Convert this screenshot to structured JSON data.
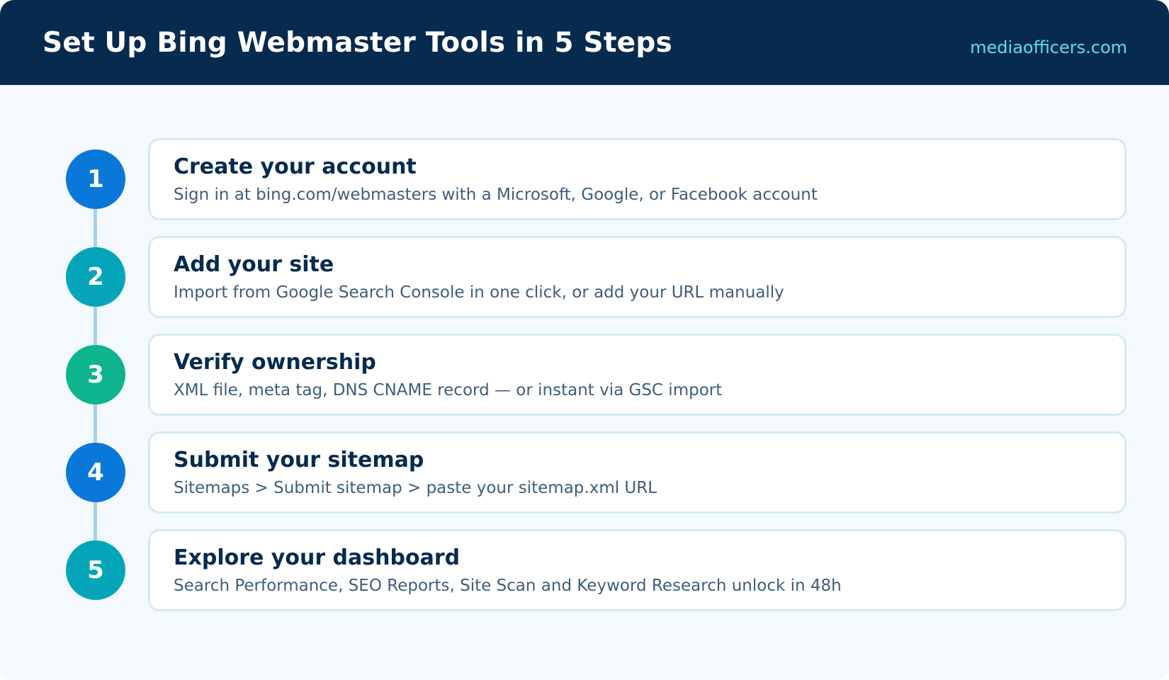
{
  "header": {
    "title": "Set Up Bing Webmaster Tools in 5 Steps",
    "brand": "mediaofficers.com"
  },
  "colors": {
    "header_bg": "#072a4f",
    "page_bg": "#f4f9fd",
    "brand_text": "#5ce1e6",
    "connector": "#a6d3ec",
    "card_border": "#d3eaf6",
    "title_text": "#072a4f",
    "desc_text": "#3f5d7a"
  },
  "steps": [
    {
      "number": "1",
      "color": "#0a78d9",
      "title": "Create your account",
      "description": "Sign in at bing.com/webmasters with a Microsoft, Google, or Facebook account"
    },
    {
      "number": "2",
      "color": "#04a5b9",
      "title": "Add your site",
      "description": "Import from Google Search Console in one click, or add your URL manually"
    },
    {
      "number": "3",
      "color": "#0db48e",
      "title": "Verify ownership",
      "description": "XML file, meta tag, DNS CNAME record — or instant via GSC import"
    },
    {
      "number": "4",
      "color": "#0a78d9",
      "title": "Submit your sitemap",
      "description": "Sitemaps > Submit sitemap > paste your sitemap.xml URL"
    },
    {
      "number": "5",
      "color": "#04a5b9",
      "title": "Explore your dashboard",
      "description": "Search Performance, SEO Reports, Site Scan and Keyword Research unlock in 48h"
    }
  ]
}
